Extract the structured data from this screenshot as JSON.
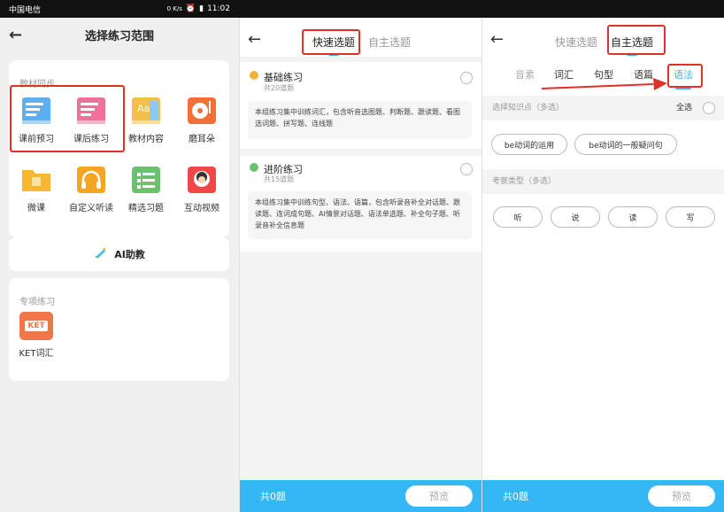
{
  "status_bar": {
    "carrier": "中国电信",
    "time": "11:02",
    "speed": "0 K/s"
  },
  "panel1": {
    "title": "选择练习范围",
    "section1_label": "教材同步",
    "grid": [
      {
        "label": "课前预习",
        "icon": "book-blue-icon",
        "color": "#5ab0f2"
      },
      {
        "label": "课后练习",
        "icon": "book-pink-icon",
        "color": "#f0709a"
      },
      {
        "label": "教材内容",
        "icon": "textbook-icon",
        "color": "#f5c04a"
      },
      {
        "label": "磨耳朵",
        "icon": "record-player-icon",
        "color": "#f07038"
      },
      {
        "label": "微课",
        "icon": "folder-icon",
        "color": "#f7b733"
      },
      {
        "label": "自定义听读",
        "icon": "headphones-icon",
        "color": "#f5a524"
      },
      {
        "label": "精选习题",
        "icon": "list-icon",
        "color": "#6cc070"
      },
      {
        "label": "互动视频",
        "icon": "avatar-video-icon",
        "color": "#f04848"
      }
    ],
    "ai_label": "AI助教",
    "section2_label": "专项练习",
    "special": [
      {
        "label": "KET词汇",
        "icon_text": "KET",
        "color": "#f07848"
      }
    ]
  },
  "panel2": {
    "tabs": [
      "快速选题",
      "自主选题"
    ],
    "active_tab": 0,
    "exercises": [
      {
        "title": "基础练习",
        "count": "共20道题",
        "desc": "本组练习集中训练词汇，包含听音选图题、判断题、跟读题、看图选词题、拼写题、连线题",
        "badge_color": "#f0b33a"
      },
      {
        "title": "进阶练习",
        "count": "共15道题",
        "desc": "本组练习集中训练句型、语法、语篇，包含听录音补全对话题、跟读题、连词成句题、AI情景对话题、语法单选题、补全句子题、听录音补全信息题",
        "badge_color": "#6cc070"
      }
    ],
    "footer_count": "共0题",
    "footer_button": "预览"
  },
  "panel3": {
    "tabs": [
      "快速选题",
      "自主选题"
    ],
    "active_tab": 1,
    "subtabs": [
      "音素",
      "词汇",
      "句型",
      "语篇",
      "语法"
    ],
    "active_subtab": 4,
    "knowledge_label": "选择知识点（多选）",
    "select_all": "全选",
    "knowledge_chips": [
      "be动词的运用",
      "be动词的一般疑问句"
    ],
    "type_label": "考察类型（多选）",
    "type_chips": [
      "听",
      "说",
      "读",
      "写"
    ],
    "footer_count": "共0题",
    "footer_button": "预览"
  },
  "colors": {
    "accent_blue": "#35b7f3",
    "highlight_red": "#e0302a"
  }
}
